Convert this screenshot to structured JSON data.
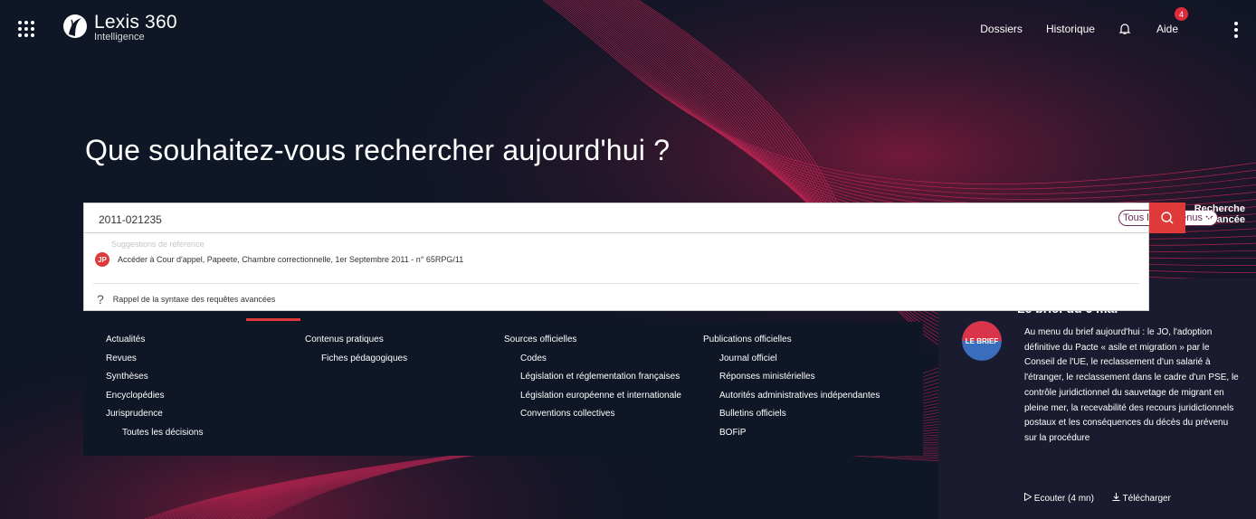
{
  "header": {
    "logo_name": "Lexis 360",
    "logo_sub": "Intelligence",
    "nav": [
      "Dossiers",
      "Historique"
    ],
    "aide_label": "Aide",
    "notification_count": "4"
  },
  "headline": "Que souhaitez-vous rechercher aujourd'hui ?",
  "search": {
    "value": "2011-021235",
    "scope": "Tous les contenus",
    "advanced_line1": "Recherche",
    "advanced_line2": "avancée"
  },
  "suggestions": {
    "title": "Suggestions de référence",
    "item_badge": "JP",
    "item_text": "Accéder à Cour d'appel, Papeete, Chambre correctionnelle, 1er Septembre 2011 - n° 65RPG/11",
    "help": "Rappel de la syntaxe des requêtes avancées"
  },
  "columns": [
    {
      "items": [
        {
          "label": "Actualités",
          "indent": false
        },
        {
          "label": "Revues",
          "indent": false
        },
        {
          "label": "Synthèses",
          "indent": false
        },
        {
          "label": "Encyclopédies",
          "indent": false
        },
        {
          "label": "Jurisprudence",
          "indent": false
        },
        {
          "label": "Toutes les décisions",
          "indent": true
        }
      ]
    },
    {
      "items": [
        {
          "label": "Contenus pratiques",
          "indent": false
        },
        {
          "label": "Fiches pédagogiques",
          "indent": true
        }
      ]
    },
    {
      "items": [
        {
          "label": "Sources officielles",
          "indent": false
        },
        {
          "label": "Codes",
          "indent": true
        },
        {
          "label": "Législation et réglementation françaises",
          "indent": true
        },
        {
          "label": "Législation européenne et internationale",
          "indent": true
        },
        {
          "label": "Conventions collectives",
          "indent": true
        }
      ]
    },
    {
      "items": [
        {
          "label": "Publications officielles",
          "indent": false
        },
        {
          "label": "Journal officiel",
          "indent": true
        },
        {
          "label": "Réponses ministérielles",
          "indent": true
        },
        {
          "label": "Autorités administratives indépendantes",
          "indent": true
        },
        {
          "label": "Bulletins officiels",
          "indent": true
        },
        {
          "label": "BOFiP",
          "indent": true
        }
      ]
    }
  ],
  "brief": {
    "title": "Le brief du 6 mai",
    "logo": "LE BRIEF",
    "text": "Au menu du brief aujourd'hui : le JO, l'adoption définitive du Pacte « asile et migration » par le Conseil de l'UE, le reclassement d'un salarié à l'étranger, le reclassement dans le cadre d'un PSE, le contrôle juridictionnel du sauvetage de migrant en pleine mer, la recevabilité des recours juridictionnels postaux et les conséquences du décès du prévenu sur la procédure",
    "listen": "Ecouter (4 mn)",
    "download": "Télécharger"
  },
  "colors": {
    "background": "#0f1626",
    "accent": "#e0393a",
    "scope_border": "#6a2c59",
    "brief_bg": "#1a1b2e"
  },
  "icons": [
    "apps-grid-icon",
    "bell-icon",
    "kebab-menu-icon",
    "search-icon",
    "chevron-down-icon",
    "play-icon",
    "download-icon",
    "question-icon"
  ]
}
